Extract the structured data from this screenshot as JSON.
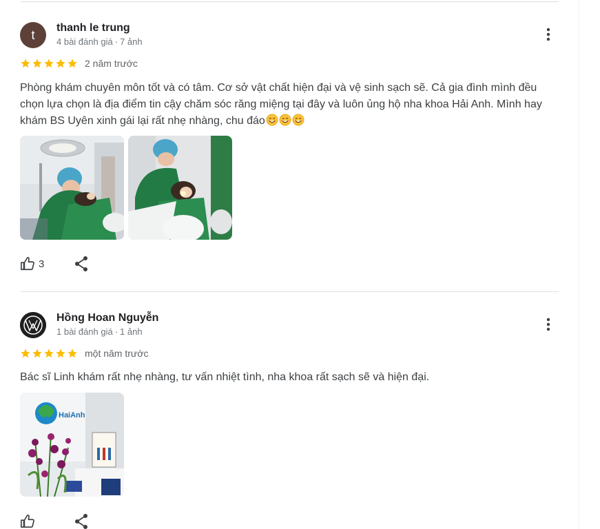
{
  "reviews": [
    {
      "avatar_letter": "t",
      "name": "thanh le trung",
      "review_count": "4 bài đánh giá",
      "photo_count": "7 ảnh",
      "rating": 5,
      "when": "2 năm trước",
      "text": "Phòng khám chuyên môn tốt và có tâm. Cơ sở vật chất hiện đại và vệ sinh sạch sẽ. Cả gia đình mình đều chọn lựa chọn là địa điểm tin cậy chăm sóc răng miệng tại đây và luôn ủng hộ nha khoa Hải Anh. Mình hay khám BS Uyên xinh gái lại rất nhẹ nhàng, chu đáo",
      "emojis": [
        "smiling-face-icon",
        "smiling-face-icon",
        "smiling-face-icon"
      ],
      "likes": "3",
      "photos": [
        "dental-exam-photo-1",
        "dental-exam-photo-2"
      ]
    },
    {
      "name": "Hồng Hoan Nguyễn",
      "review_count": "1 bài đánh giá",
      "photo_count": "1 ảnh",
      "rating": 5,
      "when": "một năm trước",
      "text": "Bác sĩ Linh khám rất nhẹ nhàng, tư vấn nhiệt tình, nha khoa rất sạch sẽ và hiện đại.",
      "likes": "",
      "photos": [
        "clinic-reception-photo"
      ]
    }
  ],
  "colors": {
    "star": "#fbbc04",
    "avatar_t": "#5d4037",
    "icon": "#3c4043"
  }
}
